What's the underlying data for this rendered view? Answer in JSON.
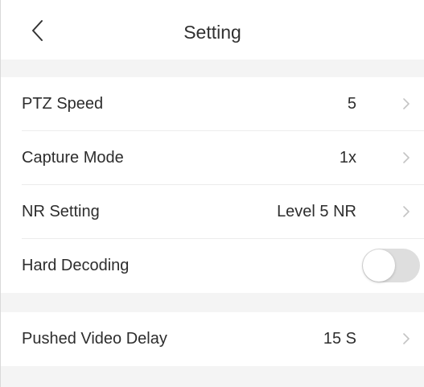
{
  "header": {
    "title": "Setting",
    "back_icon": "chevron-left-icon"
  },
  "settings": {
    "group1": [
      {
        "label": "PTZ Speed",
        "value": "5"
      },
      {
        "label": "Capture Mode",
        "value": "1x"
      },
      {
        "label": "NR Setting",
        "value": "Level 5 NR"
      },
      {
        "label": "Hard Decoding",
        "toggle_on": false
      }
    ],
    "group2": [
      {
        "label": "Pushed Video Delay",
        "value": "15 S"
      }
    ]
  },
  "colors": {
    "background": "#f4f4f4",
    "row_background": "#ffffff",
    "text": "#2d2d2d",
    "chevron": "#c4c4c4",
    "toggle_off_track": "#dedede"
  }
}
